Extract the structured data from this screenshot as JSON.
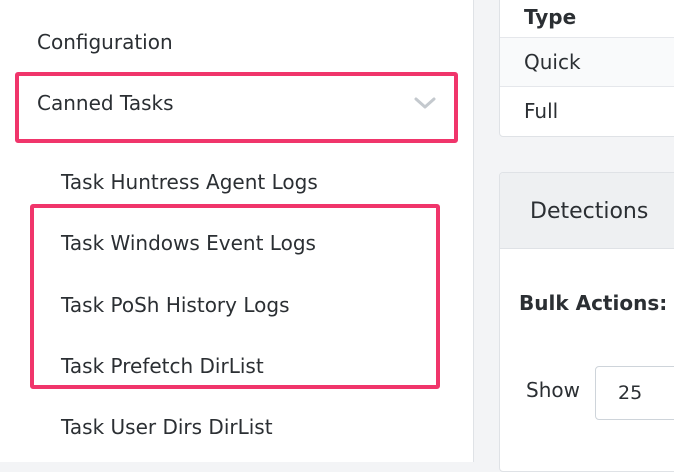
{
  "sidebar": {
    "configuration_label": "Configuration",
    "canned_tasks_label": "Canned Tasks",
    "canned_tasks_icon": "chevron-down-icon",
    "tasks": [
      {
        "label": "Task Huntress Agent Logs"
      },
      {
        "label": "Task Windows Event Logs"
      },
      {
        "label": "Task PoSh History Logs"
      },
      {
        "label": "Task Prefetch DirList"
      },
      {
        "label": "Task User Dirs DirList"
      }
    ]
  },
  "scan_table": {
    "header": "Type",
    "rows": [
      "Quick",
      "Full"
    ]
  },
  "detections": {
    "title": "Detections",
    "bulk_actions_label": "Bulk Actions:",
    "show_label": "Show",
    "show_value": "25"
  },
  "colors": {
    "highlight": "#f0356b",
    "chevron": "#c4c9ce"
  }
}
